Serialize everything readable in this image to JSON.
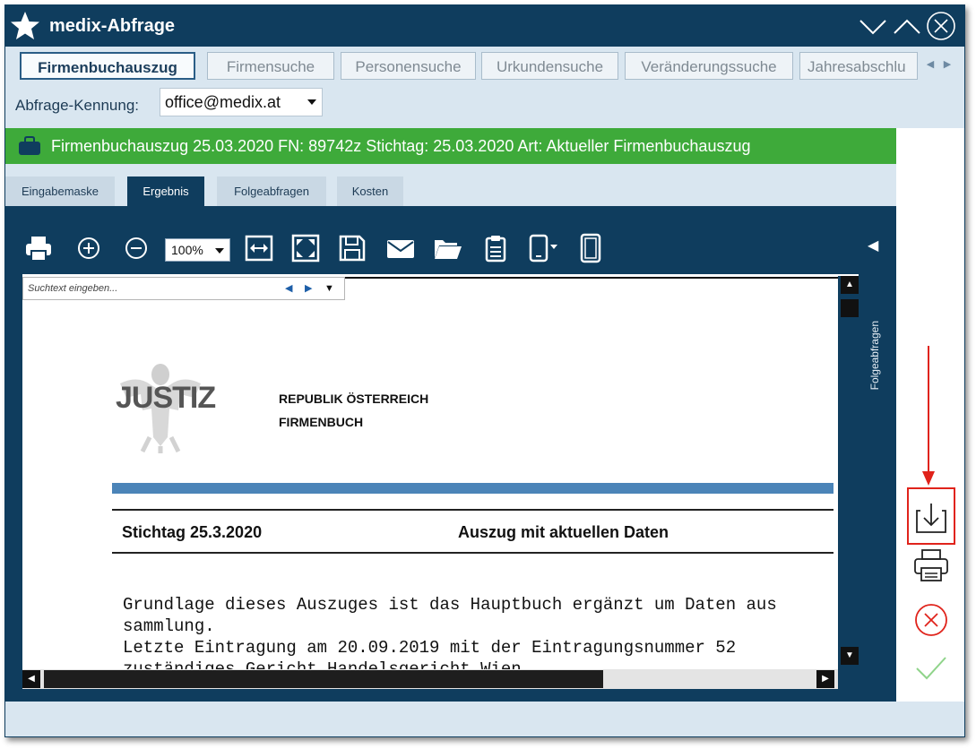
{
  "window": {
    "title": "medix-Abfrage",
    "controls": [
      "chevron-down-icon",
      "chevron-up-icon",
      "close-icon"
    ]
  },
  "main_tabs": [
    {
      "label": "Firmenbuchauszug",
      "active": true
    },
    {
      "label": "Firmensuche",
      "active": false
    },
    {
      "label": "Personensuche",
      "active": false
    },
    {
      "label": "Urkundensuche",
      "active": false
    },
    {
      "label": "Veränderungssuche",
      "active": false
    },
    {
      "label": "Jahresabschlu",
      "active": false
    }
  ],
  "kennung": {
    "label": "Abfrage-Kennung:",
    "value": "office@medix.at"
  },
  "result_bar": {
    "text": "Firmenbuchauszug 25.03.2020 FN: 89742z Stichtag: 25.03.2020 Art: Aktueller Firmenbuchauszug",
    "color": "#3eaa3a"
  },
  "sub_tabs": [
    {
      "label": "Eingabemaske",
      "active": false
    },
    {
      "label": "Ergebnis",
      "active": true
    },
    {
      "label": "Folgeabfragen",
      "active": false
    },
    {
      "label": "Kosten",
      "active": false
    }
  ],
  "toolbar": {
    "zoom": "100%",
    "icons": [
      "print-icon",
      "zoom-in-icon",
      "zoom-out-icon",
      "fit-width-icon",
      "fit-page-icon",
      "save-icon",
      "mail-icon",
      "folder-open-icon",
      "clipboard-icon",
      "page-layout-icon",
      "single-page-icon"
    ]
  },
  "search": {
    "placeholder": "Suchtext eingeben..."
  },
  "side_panel": {
    "label": "Folgeabfragen"
  },
  "document": {
    "logo_text": "JUSTIZ",
    "header_line1": "REPUBLIK ÖSTERREICH",
    "header_line2": "FIRMENBUCH",
    "stichtag": "Stichtag 25.3.2020",
    "auszug_title": "Auszug mit aktuellen Daten",
    "body_lines": [
      "Grundlage dieses Auszuges ist das Hauptbuch ergänzt um Daten aus",
      "sammlung.",
      "Letzte Eintragung am 20.09.2019 mit der Eintragungsnummer  52",
      "zuständiges Gericht Handelsgericht Wien"
    ]
  },
  "right_actions": [
    "download-icon",
    "print-icon",
    "cancel-icon",
    "confirm-icon"
  ],
  "colors": {
    "dark_blue": "#0f3d5e",
    "green": "#3eaa3a",
    "highlight_red": "#e0231b",
    "doc_blue_bar": "#4b84b8"
  }
}
